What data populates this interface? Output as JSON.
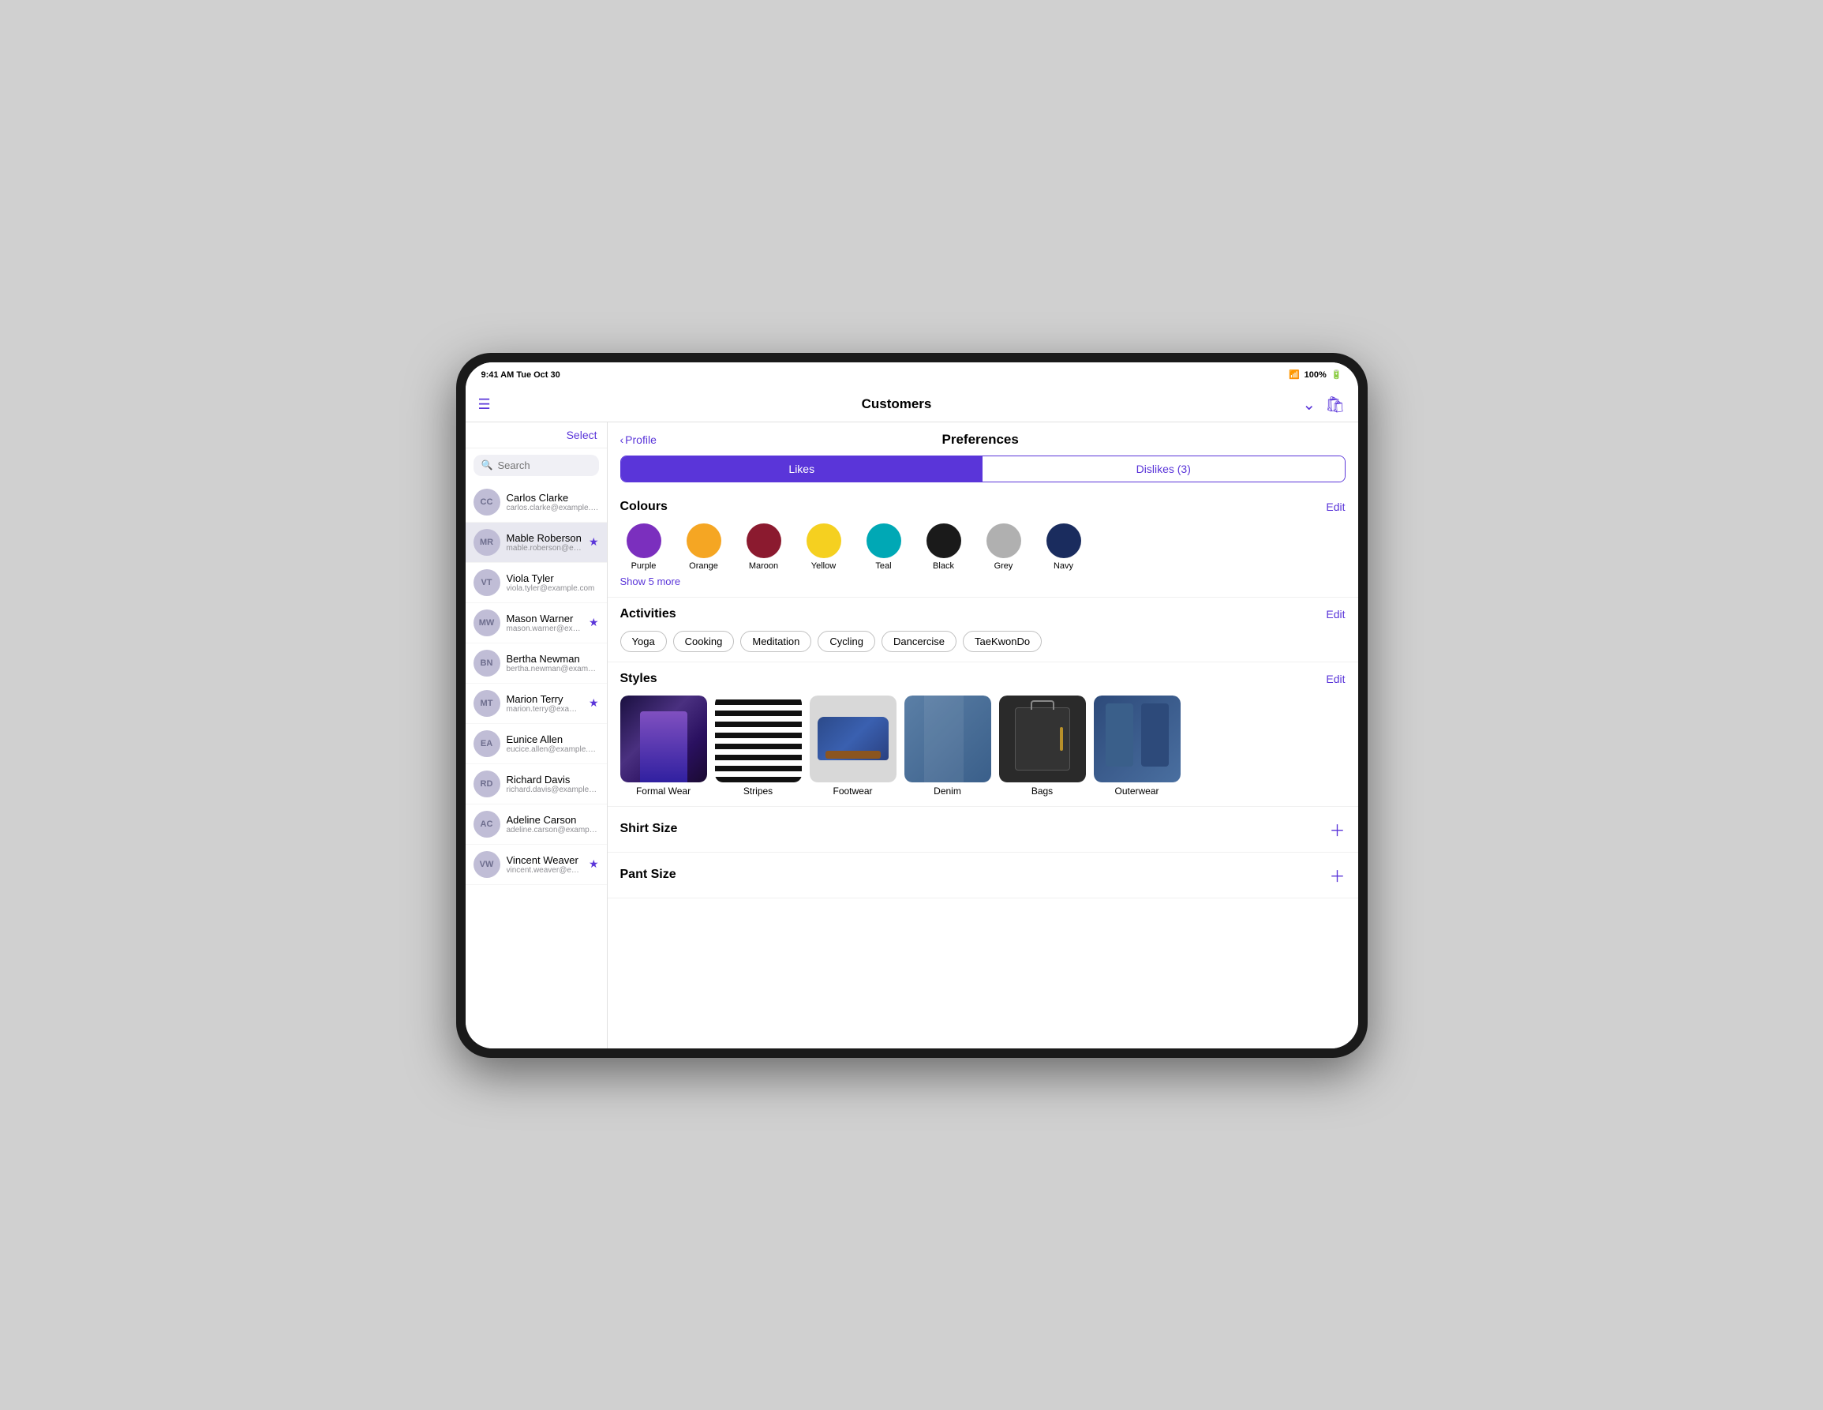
{
  "device": {
    "status_bar": {
      "time": "9:41 AM  Tue Oct 30",
      "battery": "100%"
    }
  },
  "nav": {
    "title": "Customers"
  },
  "sidebar": {
    "select_label": "Select",
    "search_placeholder": "Search",
    "customers": [
      {
        "initials": "CC",
        "name": "Carlos Clarke",
        "email": "carlos.clarke@example.com",
        "starred": false,
        "active": false
      },
      {
        "initials": "MR",
        "name": "Mable Roberson",
        "email": "mable.roberson@example.com",
        "starred": true,
        "active": true
      },
      {
        "initials": "VT",
        "name": "Viola Tyler",
        "email": "viola.tyler@example.com",
        "starred": false,
        "active": false
      },
      {
        "initials": "MW",
        "name": "Mason Warner",
        "email": "mason.warner@example.com",
        "starred": true,
        "active": false
      },
      {
        "initials": "BN",
        "name": "Bertha Newman",
        "email": "bertha.newman@example.com",
        "starred": false,
        "active": false
      },
      {
        "initials": "MT",
        "name": "Marion Terry",
        "email": "marion.terry@example.com",
        "starred": true,
        "active": false
      },
      {
        "initials": "EA",
        "name": "Eunice Allen",
        "email": "eucice.allen@example.com",
        "starred": false,
        "active": false
      },
      {
        "initials": "RD",
        "name": "Richard Davis",
        "email": "richard.davis@example.com",
        "starred": false,
        "active": false
      },
      {
        "initials": "AC",
        "name": "Adeline Carson",
        "email": "adeline.carson@example.com",
        "starred": false,
        "active": false
      },
      {
        "initials": "VW",
        "name": "Vincent Weaver",
        "email": "vincent.weaver@example.com",
        "starred": true,
        "active": false
      }
    ]
  },
  "detail": {
    "back_label": "Profile",
    "section_title": "Preferences",
    "tabs": {
      "likes_label": "Likes",
      "dislikes_label": "Dislikes (3)"
    },
    "colours": {
      "label": "Colours",
      "edit_label": "Edit",
      "items": [
        {
          "name": "Purple",
          "hex": "#7b2fbe"
        },
        {
          "name": "Orange",
          "hex": "#f5a623"
        },
        {
          "name": "Maroon",
          "hex": "#8b1a2f"
        },
        {
          "name": "Yellow",
          "hex": "#f5d020"
        },
        {
          "name": "Teal",
          "hex": "#00a8b5"
        },
        {
          "name": "Black",
          "hex": "#1a1a1a"
        },
        {
          "name": "Grey",
          "hex": "#b0b0b0"
        },
        {
          "name": "Navy",
          "hex": "#1a2c5e"
        }
      ],
      "show_more_label": "Show 5 more"
    },
    "activities": {
      "label": "Activities",
      "edit_label": "Edit",
      "items": [
        "Yoga",
        "Cooking",
        "Meditation",
        "Cycling",
        "Dancercise",
        "TaeKwonDo"
      ]
    },
    "styles": {
      "label": "Styles",
      "edit_label": "Edit",
      "items": [
        {
          "name": "Formal Wear",
          "style": "formal"
        },
        {
          "name": "Stripes",
          "style": "stripes"
        },
        {
          "name": "Footwear",
          "style": "footwear"
        },
        {
          "name": "Denim",
          "style": "denim"
        },
        {
          "name": "Bags",
          "style": "bags"
        },
        {
          "name": "Outerwear",
          "style": "outerwear"
        }
      ]
    },
    "shirt_size": {
      "label": "Shirt Size"
    },
    "pant_size": {
      "label": "Pant Size"
    }
  }
}
